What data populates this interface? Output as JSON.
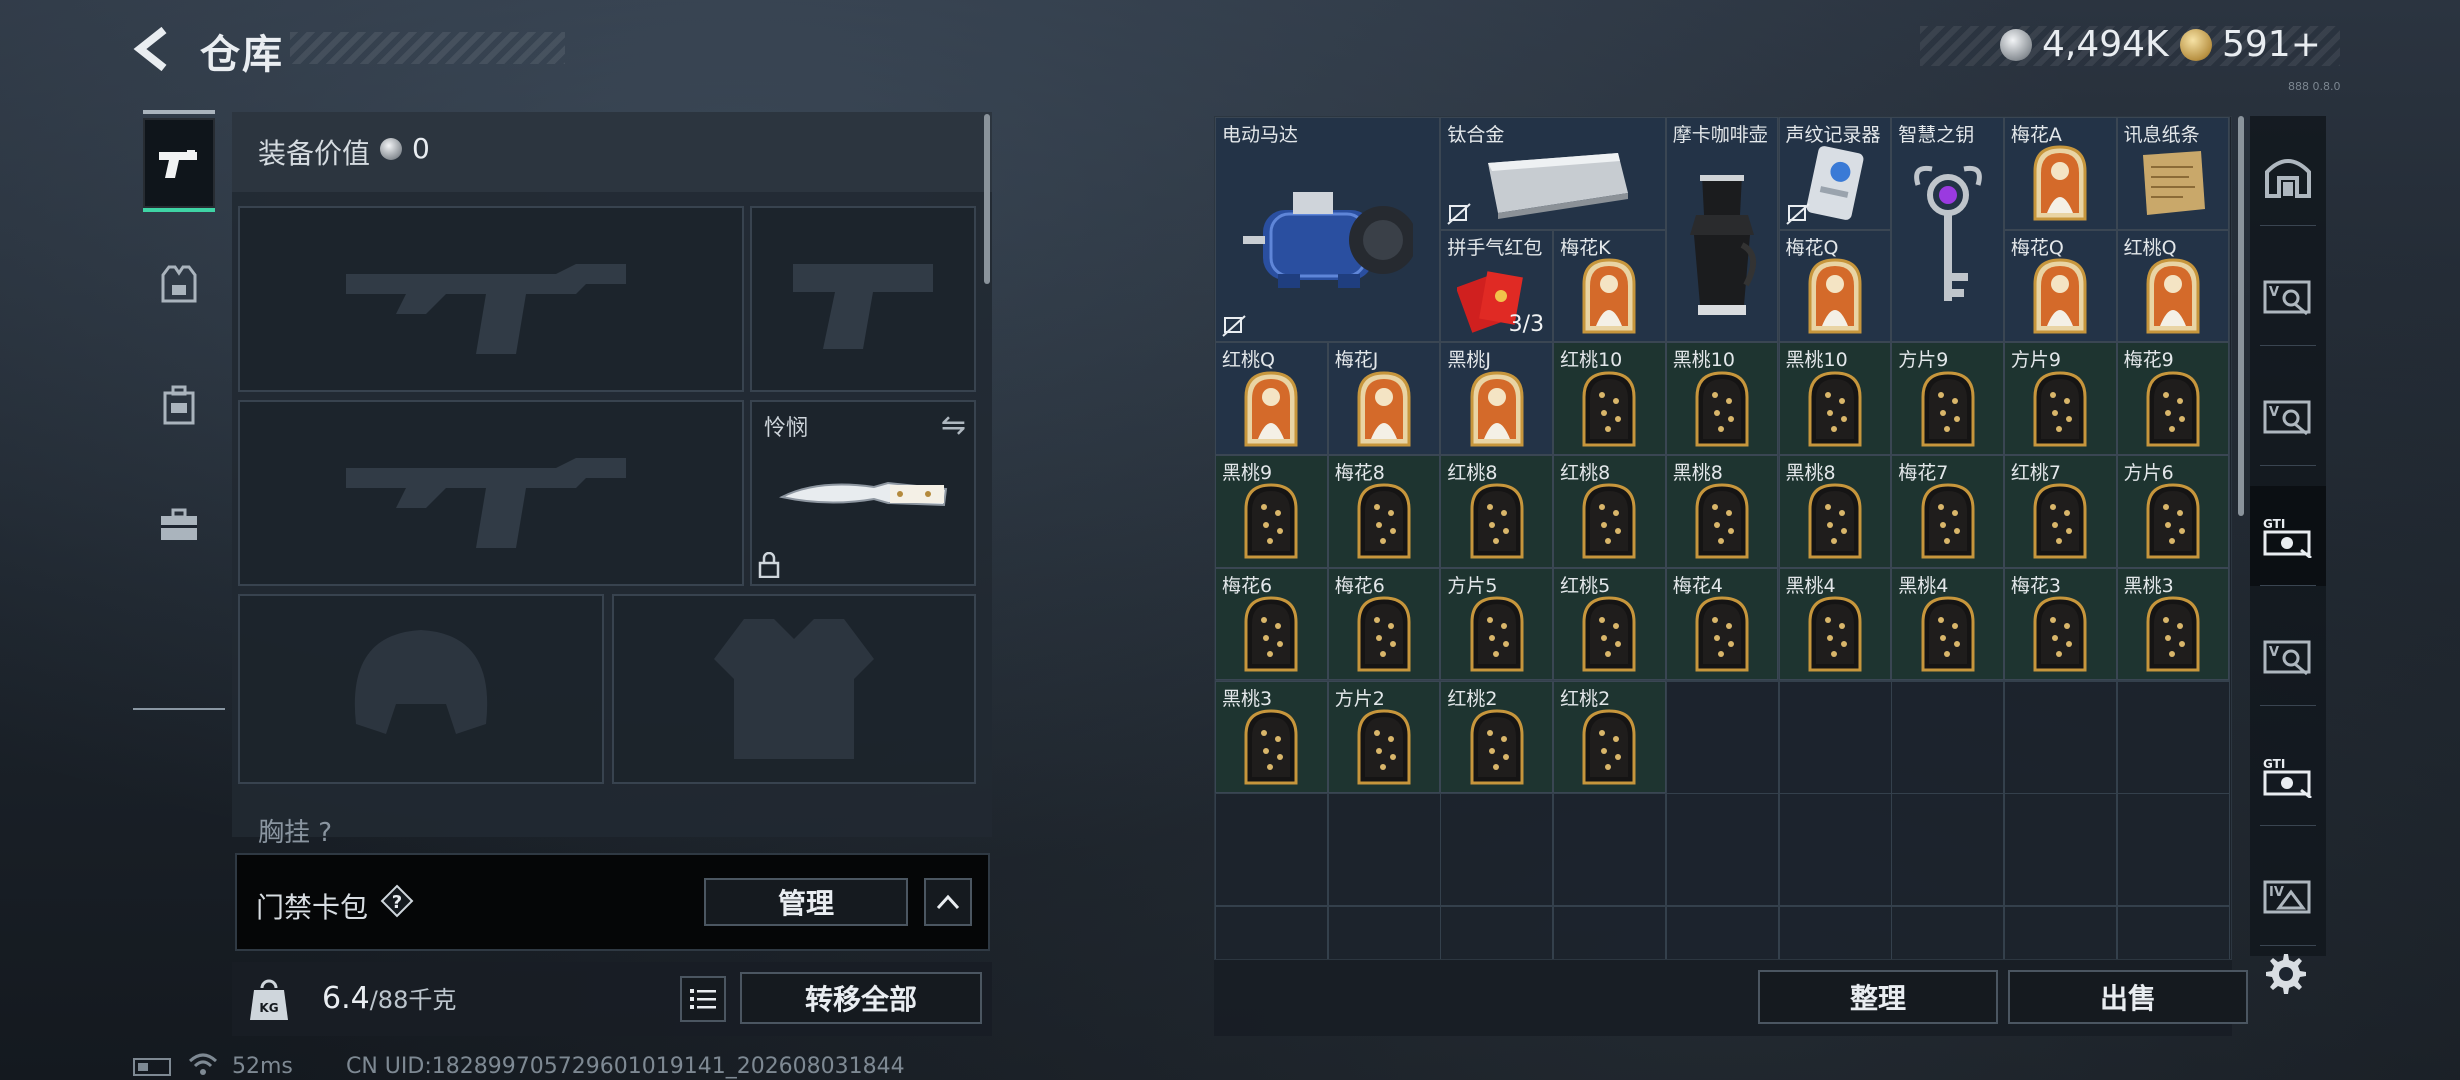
{
  "header": {
    "title": "仓库"
  },
  "currency": {
    "silver": "4,494K",
    "gold": "591+",
    "build": "888 0.8.0"
  },
  "equipment": {
    "value_label": "装备价值",
    "value": "0",
    "knife_label": "怜悯",
    "chest_label": "胸挂",
    "chest_help": "?"
  },
  "keycard": {
    "label": "门禁卡包",
    "help": "?",
    "manage": "管理"
  },
  "weight": {
    "current": "6.4",
    "max": "/88千克",
    "transfer_all": "转移全部"
  },
  "storage": {
    "sort_label": "整理",
    "sell_label": "出售",
    "items": [
      {
        "name": "电动马达",
        "col": 0,
        "row": 0,
        "w": 2,
        "h": 2,
        "rarity": "blue",
        "icon": "motor-icon",
        "no_durability": true
      },
      {
        "name": "钛合金",
        "col": 2,
        "row": 0,
        "w": 2,
        "h": 1,
        "rarity": "blue",
        "icon": "titanium-ingot-icon",
        "no_durability": true
      },
      {
        "name": "摩卡咖啡壶",
        "col": 4,
        "row": 0,
        "w": 1,
        "h": 2,
        "rarity": "blue",
        "icon": "moka-pot-icon"
      },
      {
        "name": "声纹记录器",
        "col": 5,
        "row": 0,
        "w": 1,
        "h": 1,
        "rarity": "blue",
        "icon": "voice-recorder-icon",
        "no_durability": true
      },
      {
        "name": "智慧之钥",
        "col": 6,
        "row": 0,
        "w": 1,
        "h": 2,
        "rarity": "blue",
        "icon": "key-icon"
      },
      {
        "name": "梅花A",
        "col": 7,
        "row": 0,
        "w": 1,
        "h": 1,
        "rarity": "blue",
        "icon": "card-portrait-icon"
      },
      {
        "name": "讯息纸条",
        "col": 8,
        "row": 0,
        "w": 1,
        "h": 1,
        "rarity": "blue",
        "icon": "paper-note-icon"
      },
      {
        "name": "拼手气红包",
        "col": 2,
        "row": 1,
        "w": 1,
        "h": 1,
        "rarity": "blue",
        "icon": "red-envelope-icon",
        "count": "3/3"
      },
      {
        "name": "梅花K",
        "col": 3,
        "row": 1,
        "w": 1,
        "h": 1,
        "rarity": "blue",
        "icon": "card-portrait-icon"
      },
      {
        "name": "梅花Q",
        "col": 5,
        "row": 1,
        "w": 1,
        "h": 1,
        "rarity": "blue",
        "icon": "card-portrait-icon"
      },
      {
        "name": "梅花Q",
        "col": 7,
        "row": 1,
        "w": 1,
        "h": 1,
        "rarity": "blue",
        "icon": "card-portrait-icon"
      },
      {
        "name": "红桃Q",
        "col": 8,
        "row": 1,
        "w": 1,
        "h": 1,
        "rarity": "blue",
        "icon": "card-portrait-icon"
      },
      {
        "name": "红桃Q",
        "col": 0,
        "row": 2,
        "w": 1,
        "h": 1,
        "rarity": "blue",
        "icon": "card-portrait-icon"
      },
      {
        "name": "梅花J",
        "col": 1,
        "row": 2,
        "w": 1,
        "h": 1,
        "rarity": "blue",
        "icon": "card-portrait-icon"
      },
      {
        "name": "黑桃J",
        "col": 2,
        "row": 2,
        "w": 1,
        "h": 1,
        "rarity": "blue",
        "icon": "card-portrait-icon"
      },
      {
        "name": "红桃10",
        "col": 3,
        "row": 2,
        "w": 1,
        "h": 1,
        "rarity": "green",
        "icon": "card-pips-icon"
      },
      {
        "name": "黑桃10",
        "col": 4,
        "row": 2,
        "w": 1,
        "h": 1,
        "rarity": "green",
        "icon": "card-pips-icon"
      },
      {
        "name": "黑桃10",
        "col": 5,
        "row": 2,
        "w": 1,
        "h": 1,
        "rarity": "green",
        "icon": "card-pips-icon"
      },
      {
        "name": "方片9",
        "col": 6,
        "row": 2,
        "w": 1,
        "h": 1,
        "rarity": "green",
        "icon": "card-pips-icon"
      },
      {
        "name": "方片9",
        "col": 7,
        "row": 2,
        "w": 1,
        "h": 1,
        "rarity": "green",
        "icon": "card-pips-icon"
      },
      {
        "name": "梅花9",
        "col": 8,
        "row": 2,
        "w": 1,
        "h": 1,
        "rarity": "green",
        "icon": "card-pips-icon"
      },
      {
        "name": "黑桃9",
        "col": 0,
        "row": 3,
        "w": 1,
        "h": 1,
        "rarity": "green",
        "icon": "card-pips-icon"
      },
      {
        "name": "梅花8",
        "col": 1,
        "row": 3,
        "w": 1,
        "h": 1,
        "rarity": "green",
        "icon": "card-pips-icon"
      },
      {
        "name": "红桃8",
        "col": 2,
        "row": 3,
        "w": 1,
        "h": 1,
        "rarity": "green",
        "icon": "card-pips-icon"
      },
      {
        "name": "红桃8",
        "col": 3,
        "row": 3,
        "w": 1,
        "h": 1,
        "rarity": "green",
        "icon": "card-pips-icon"
      },
      {
        "name": "黑桃8",
        "col": 4,
        "row": 3,
        "w": 1,
        "h": 1,
        "rarity": "green",
        "icon": "card-pips-icon"
      },
      {
        "name": "黑桃8",
        "col": 5,
        "row": 3,
        "w": 1,
        "h": 1,
        "rarity": "green",
        "icon": "card-pips-icon"
      },
      {
        "name": "梅花7",
        "col": 6,
        "row": 3,
        "w": 1,
        "h": 1,
        "rarity": "green",
        "icon": "card-pips-icon"
      },
      {
        "name": "红桃7",
        "col": 7,
        "row": 3,
        "w": 1,
        "h": 1,
        "rarity": "green",
        "icon": "card-pips-icon"
      },
      {
        "name": "方片6",
        "col": 8,
        "row": 3,
        "w": 1,
        "h": 1,
        "rarity": "green",
        "icon": "card-pips-icon"
      },
      {
        "name": "梅花6",
        "col": 0,
        "row": 4,
        "w": 1,
        "h": 1,
        "rarity": "green",
        "icon": "card-pips-icon"
      },
      {
        "name": "梅花6",
        "col": 1,
        "row": 4,
        "w": 1,
        "h": 1,
        "rarity": "green",
        "icon": "card-pips-icon"
      },
      {
        "name": "方片5",
        "col": 2,
        "row": 4,
        "w": 1,
        "h": 1,
        "rarity": "green",
        "icon": "card-pips-icon"
      },
      {
        "name": "红桃5",
        "col": 3,
        "row": 4,
        "w": 1,
        "h": 1,
        "rarity": "green",
        "icon": "card-pips-icon"
      },
      {
        "name": "梅花4",
        "col": 4,
        "row": 4,
        "w": 1,
        "h": 1,
        "rarity": "green",
        "icon": "card-pips-icon"
      },
      {
        "name": "黑桃4",
        "col": 5,
        "row": 4,
        "w": 1,
        "h": 1,
        "rarity": "green",
        "icon": "card-pips-icon"
      },
      {
        "name": "黑桃4",
        "col": 6,
        "row": 4,
        "w": 1,
        "h": 1,
        "rarity": "green",
        "icon": "card-pips-icon"
      },
      {
        "name": "梅花3",
        "col": 7,
        "row": 4,
        "w": 1,
        "h": 1,
        "rarity": "green",
        "icon": "card-pips-icon"
      },
      {
        "name": "黑桃3",
        "col": 8,
        "row": 4,
        "w": 1,
        "h": 1,
        "rarity": "green",
        "icon": "card-pips-icon"
      },
      {
        "name": "黑桃3",
        "col": 0,
        "row": 5,
        "w": 1,
        "h": 1,
        "rarity": "green",
        "icon": "card-pips-icon"
      },
      {
        "name": "方片2",
        "col": 1,
        "row": 5,
        "w": 1,
        "h": 1,
        "rarity": "green",
        "icon": "card-pips-icon"
      },
      {
        "name": "红桃2",
        "col": 2,
        "row": 5,
        "w": 1,
        "h": 1,
        "rarity": "green",
        "icon": "card-pips-icon"
      },
      {
        "name": "红桃2",
        "col": 3,
        "row": 5,
        "w": 1,
        "h": 1,
        "rarity": "green",
        "icon": "card-pips-icon"
      }
    ]
  },
  "right_tabs": [
    "bunker-icon",
    "tier-v-case-icon",
    "tier-v-case-icon",
    "gti-case-icon",
    "tier-v-case-icon",
    "gti-case-icon",
    "tier-iv-case-icon"
  ],
  "status": {
    "ping": "52ms",
    "uid": "CN UID:1828997057296010191­41_202608031844"
  },
  "colors": {
    "accent": "#3fd4a5",
    "blue_rarity": "#233347",
    "green_rarity": "#1e3430"
  }
}
